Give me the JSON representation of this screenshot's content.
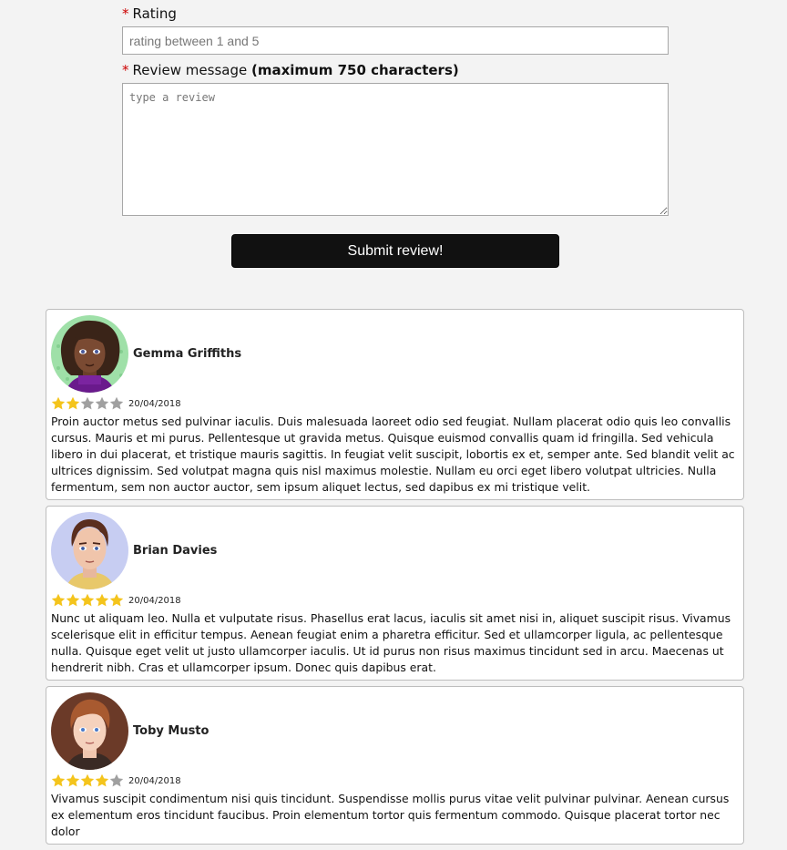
{
  "form": {
    "rating_label": "Rating",
    "rating_placeholder": "rating between 1 and 5",
    "review_label": "Review message",
    "review_label_bold": "(maximum 750 characters)",
    "review_placeholder": "type a review",
    "submit_label": "Submit review!",
    "required_marker": "*"
  },
  "colors": {
    "star_filled": "#f4c41c",
    "star_empty": "#a0a0a0",
    "required": "#cc0000",
    "button_bg": "#111111"
  },
  "reviews": [
    {
      "name": "Gemma Griffiths",
      "avatar_icon": "avatar-woman-curly-hair-icon",
      "rating": 2,
      "date": "20/04/2018",
      "text": "Proin auctor metus sed pulvinar iaculis. Duis malesuada laoreet odio sed feugiat. Nullam placerat odio quis leo convallis cursus. Mauris et mi purus. Pellentesque ut gravida metus. Quisque euismod convallis quam id fringilla. Sed vehicula libero in dui placerat, et tristique mauris sagittis. In feugiat velit suscipit, lobortis ex et, semper ante. Sed blandit velit ac ultrices dignissim. Sed volutpat magna quis nisl maximus molestie. Nullam eu orci eget libero volutpat ultricies. Nulla fermentum, sem non auctor auctor, sem ipsum aliquet lectus, sed dapibus ex mi tristique velit."
    },
    {
      "name": "Brian Davies",
      "avatar_icon": "avatar-man-receding-hair-icon",
      "rating": 5,
      "date": "20/04/2018",
      "text": "Nunc ut aliquam leo. Nulla et vulputate risus. Phasellus erat lacus, iaculis sit amet nisi in, aliquet suscipit risus. Vivamus scelerisque elit in efficitur tempus. Aenean feugiat enim a pharetra efficitur. Sed et ullamcorper ligula, ac pellentesque nulla. Quisque eget velit ut justo ullamcorper iaculis. Ut id purus non risus maximus tincidunt sed in arcu. Maecenas ut hendrerit nibh. Cras et ullamcorper ipsum. Donec quis dapibus erat."
    },
    {
      "name": "Toby Musto",
      "avatar_icon": "avatar-man-brown-hair-icon",
      "rating": 4,
      "date": "20/04/2018",
      "text": "Vivamus suscipit condimentum nisi quis tincidunt. Suspendisse mollis purus vitae velit pulvinar pulvinar. Aenean cursus ex elementum eros tincidunt faucibus. Proin elementum tortor quis fermentum commodo. Quisque placerat tortor nec dolor"
    }
  ]
}
